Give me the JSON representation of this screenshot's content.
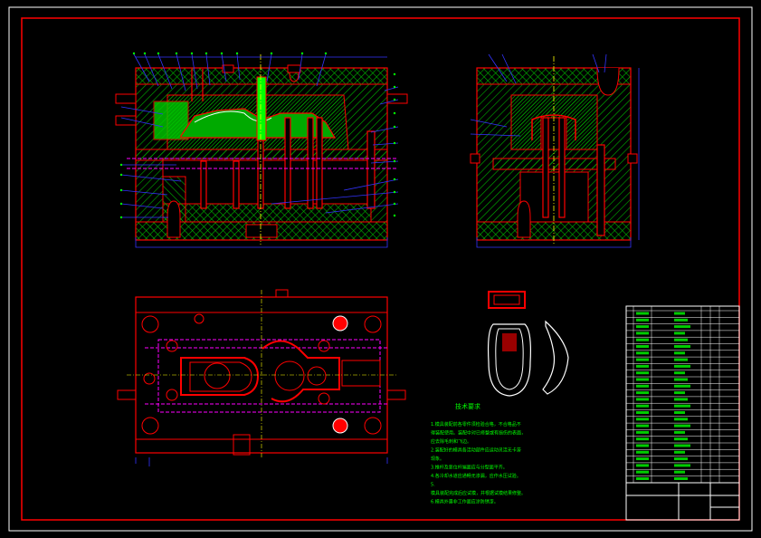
{
  "drawing": {
    "title": "技术要求",
    "colors": {
      "background": "#000000",
      "frame": "#ff0000",
      "outline": "#ffffff",
      "section": "#ff0000",
      "hatch": "#00cc00",
      "dimension": "#3333ff",
      "text": "#00ff00",
      "hidden": "#ff00ff",
      "center": "#ffff00"
    },
    "requirements": [
      "1.模具装配前各零件须检验合格，不合格品不",
      "得装配使用。装配中对已修整或有损伤的表面，",
      "应去除毛刺和飞边。",
      "2.装配好的模具各活动部件应运动灵活无卡滞",
      "现象。",
      "3.推杆及复位杆端面应与分型面平齐。",
      "4.各冷却水道应通畅无渗漏，应作水压试验。",
      "5.",
      "模具装配完成后应试模，并根据试模结果修整。",
      "6.模具外露非工作面应涂防锈漆。"
    ],
    "title_block": {
      "drawing_no": "",
      "name": ""
    }
  }
}
